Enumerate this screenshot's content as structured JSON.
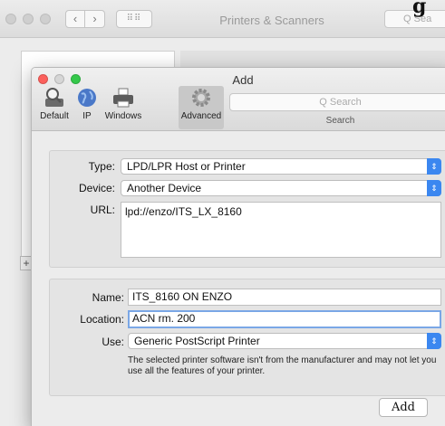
{
  "back_window": {
    "title": "Printers & Scanners",
    "search_placeholder": "Q Sea",
    "nav_back": "‹",
    "nav_forward": "›",
    "grid": "⠿⠿",
    "corner_glyph": "g",
    "plus": "+"
  },
  "dialog": {
    "title": "Add",
    "toolbar": {
      "items": [
        {
          "label": "Default",
          "icon": "magnifier-printer-icon"
        },
        {
          "label": "IP",
          "icon": "globe-icon"
        },
        {
          "label": "Windows",
          "icon": "printer-icon"
        },
        {
          "label": "Advanced",
          "icon": "gear-icon",
          "active": true
        }
      ],
      "search_placeholder": "Q Search",
      "search_label": "Search"
    },
    "form": {
      "type_label": "Type:",
      "type_value": "LPD/LPR Host or Printer",
      "device_label": "Device:",
      "device_value": "Another Device",
      "url_label": "URL:",
      "url_value": "lpd://enzo/ITS_LX_8160",
      "name_label": "Name:",
      "name_value": "ITS_8160 ON ENZO",
      "location_label": "Location:",
      "location_value": "ACN rm. 200",
      "use_label": "Use:",
      "use_value": "Generic PostScript Printer",
      "note_line1": "The selected printer software isn't from the manufacturer and may not let you",
      "note_line2": "use all the features of your printer."
    },
    "add_button": "Add"
  },
  "colors": {
    "accent": "#3b87f0",
    "close": "#fc605c",
    "minimize": "#fdbc40",
    "zoom": "#34c84a"
  }
}
